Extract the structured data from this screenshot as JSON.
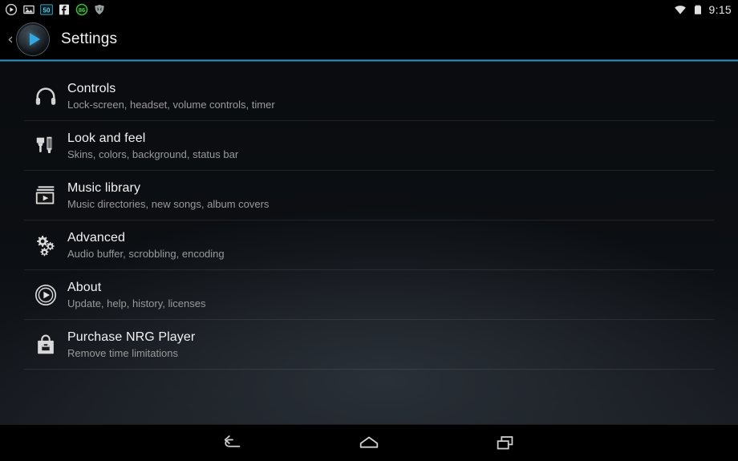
{
  "status_bar": {
    "left_icons": [
      {
        "name": "play-circle-notification-icon",
        "label": "play"
      },
      {
        "name": "image-notification-icon",
        "label": "image"
      },
      {
        "name": "counter-50-badge-icon",
        "label": "50"
      },
      {
        "name": "facebook-notification-icon",
        "label": "f"
      },
      {
        "name": "counter-86-badge-icon",
        "label": "86"
      },
      {
        "name": "shield-notification-icon",
        "label": "shield"
      }
    ],
    "wifi_icon": "wifi-icon",
    "battery_icon": "battery-icon",
    "clock": "9:15"
  },
  "action_bar": {
    "back_chevron": "‹",
    "logo_icon": "nrg-player-logo-icon",
    "title": "Settings"
  },
  "colors": {
    "accent": "#2fa4d8",
    "title_text": "#f2f2f2",
    "subtitle_text": "#9a9a9a",
    "logo_triangle": "#35a7e0"
  },
  "settings": {
    "items": [
      {
        "icon": "headphones-icon",
        "title": "Controls",
        "subtitle": "Lock-screen, headset, volume controls, timer"
      },
      {
        "icon": "paintbrush-icon",
        "title": "Look and feel",
        "subtitle": "Skins, colors, background, status bar"
      },
      {
        "icon": "music-library-icon",
        "title": "Music library",
        "subtitle": "Music directories, new songs, album covers"
      },
      {
        "icon": "gears-icon",
        "title": "Advanced",
        "subtitle": "Audio buffer, scrobbling, encoding"
      },
      {
        "icon": "play-circle-icon",
        "title": "About",
        "subtitle": "Update, help, history, licenses"
      },
      {
        "icon": "shopping-bag-icon",
        "title": "Purchase NRG Player",
        "subtitle": "Remove time limitations"
      }
    ]
  },
  "nav_bar": {
    "back": "back-nav-icon",
    "home": "home-nav-icon",
    "recents": "recents-nav-icon"
  }
}
